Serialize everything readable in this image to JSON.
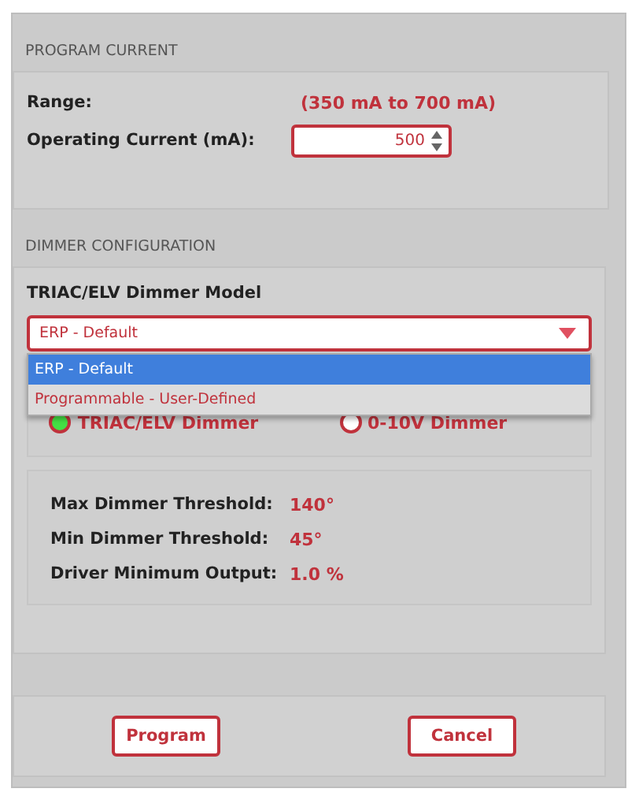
{
  "program_current": {
    "heading": "PROGRAM CURRENT",
    "range_label": "Range:",
    "range_value": "(350 mA to 700 mA)",
    "current_label": "Operating Current (mA):",
    "current_value": "500"
  },
  "dimmer_configuration": {
    "heading": "DIMMER CONFIGURATION",
    "model_label": "TRIAC/ELV Dimmer Model",
    "model_select": {
      "value": "ERP - Default",
      "expanded": true,
      "options": [
        {
          "label": "ERP - Default",
          "selected": true
        },
        {
          "label": "Programmable - User-Defined",
          "selected": false
        }
      ]
    },
    "dimmer_types": [
      {
        "label": "TRIAC/ELV Dimmer",
        "selected": true
      },
      {
        "label": "0-10V Dimmer",
        "selected": false
      }
    ],
    "thresholds": [
      {
        "label": "Max Dimmer Threshold:",
        "value": "140°"
      },
      {
        "label": "Min Dimmer Threshold:",
        "value": "45°"
      },
      {
        "label": "Driver Minimum Output:",
        "value": "1.0 %"
      }
    ]
  },
  "buttons": [
    "Program",
    "Cancel"
  ]
}
